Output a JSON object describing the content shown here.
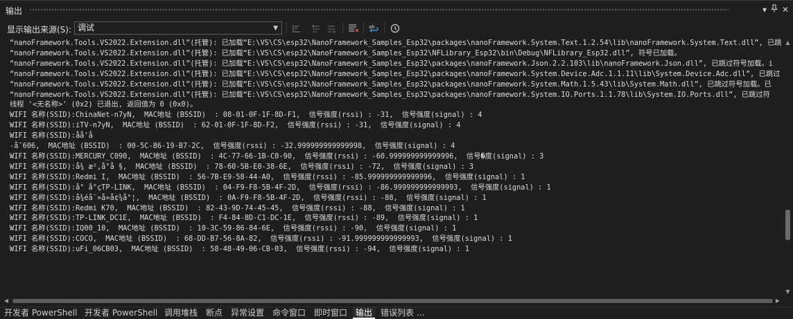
{
  "window": {
    "title": "输出"
  },
  "toolbar": {
    "source_label": "显示输出来源(S):",
    "source_value": "调试"
  },
  "output": {
    "lines": [
      "“nanoFramework.Tools.VS2022.Extension.dll”(托管): 已加载“E:\\VS\\CS\\esp32\\NanoFramework_Samples_Esp32\\packages\\nanoFramework.System.Text.1.2.54\\lib\\nanoFramework.System.Text.dll”, 已跳",
      "“nanoFramework.Tools.VS2022.Extension.dll”(托管): 已加载“E:\\VS\\CS\\esp32\\NanoFramework_Samples_Esp32\\NFLibrary_Esp32\\bin\\Debug\\NFLibrary_Esp32.dll”, 符号已加载。",
      "“nanoFramework.Tools.VS2022.Extension.dll”(托管): 已加载“E:\\VS\\CS\\esp32\\NanoFramework_Samples_Esp32\\packages\\nanoFramework.Json.2.2.103\\lib\\nanoFramework.Json.dll”, 已跳过符号加载。i",
      "“nanoFramework.Tools.VS2022.Extension.dll”(托管): 已加载“E:\\VS\\CS\\esp32\\NanoFramework_Samples_Esp32\\packages\\nanoFramework.System.Device.Adc.1.1.11\\lib\\System.Device.Adc.dll”, 已跳过",
      "“nanoFramework.Tools.VS2022.Extension.dll”(托管): 已加载“E:\\VS\\CS\\esp32\\NanoFramework_Samples_Esp32\\packages\\nanoFramework.System.Math.1.5.43\\lib\\System.Math.dll”, 已跳过符号加载。已",
      "“nanoFramework.Tools.VS2022.Extension.dll”(托管): 已加载“E:\\VS\\CS\\esp32\\NanoFramework_Samples_Esp32\\packages\\nanoFramework.System.IO.Ports.1.1.78\\lib\\System.IO.Ports.dll”, 已跳过符",
      "线程 '<无名称>' (0x2) 已退出, 返回值为 0 (0x0)。",
      "WIFI 名称(SSID):ChinaNet-n7yN,  MAC地址 (BSSID)  : 08-01-0F-1F-8D-F1,  信号强度(rssi) : -31,  信号强度(signal) : 4",
      "WIFI 名称(SSID):iTV-n7yN,  MAC地址 (BSSID)  : 62-01-0F-1F-8D-F2,  信号强度(rssi) : -31,  信号强度(signal) : 4",
      "WIFI 名称(SSID):åå'å",
      "-å¯606,  MAC地址 (BSSID)  : 00-5C-86-19-B7-2C,  信号强度(rssi) : -32.999999999999998,  信号强度(signal) : 4",
      "WIFI 名称(SSID):MERCURY_C090,  MAC地址 (BSSID)  : 4C-77-66-1B-C0-90,  信号强度(rssi) : -60.999999999999996,  信号�度(signal) : 3",
      "WIFI 名称(SSID):å¾ æ²,å°å §,  MAC地址 (BSSID)  : 78-60-5B-E0-38-6E,  信号强度(rssi) : -72,  信号强度(signal) : 3",
      "WIFI 名称(SSID):Redmi I,  MAC地址 (BSSID)  : 56-7B-E9-58-44-A0,  信号强度(rssi) : -85.999999999999996,  信号强度(signal) : 1",
      "WIFI 名称(SSID):å° å°çTP-LINK,  MAC地址 (BSSID)  : 04-F9-F8-5B-4F-2D,  信号强度(rssi) : -86.999999999999993,  信号强度(signal) : 1",
      "WIFI 名称(SSID):å¾éå¨»å»å¢¾å°¦,  MAC地址 (BSSID)  : 0A-F9-F8-5B-4F-2D,  信号强度(rssi) : -88,  信号强度(signal) : 1",
      "WIFI 名称(SSID):Redmi K70,  MAC地址 (BSSID)  : 82-43-9D-74-45-45,  信号强度(rssi) : -88,  信号强度(signal) : 1",
      "WIFI 名称(SSID):TP-LINK_DC1E,  MAC地址 (BSSID)  : F4-84-8D-C1-DC-1E,  信号强度(rssi) : -89,  信号强度(signal) : 1",
      "WIFI 名称(SSID):IQ00_10,  MAC地址 (BSSID)  : 10-3C-59-86-84-6E,  信号强度(rssi) : -90,  信号强度(signal) : 1",
      "WIFI 名称(SSID):COCO,  MAC地址 (BSSID)  : 68-DD-B7-56-8A-82,  信号强度(rssi) : -91.999999999999993,  信号强度(signal) : 1",
      "WIFI 名称(SSID):uFi_06CB03,  MAC地址 (BSSID)  : 58-48-49-06-CB-03,  信号强度(rssi) : -94,  信号强度(signal) : 1"
    ]
  },
  "tabs": [
    {
      "label": "开发者 PowerShell",
      "active": false
    },
    {
      "label": "开发者 PowerShell",
      "active": false
    },
    {
      "label": "调用堆栈",
      "active": false
    },
    {
      "label": "断点",
      "active": false
    },
    {
      "label": "异常设置",
      "active": false
    },
    {
      "label": "命令窗口",
      "active": false
    },
    {
      "label": "即时窗口",
      "active": false
    },
    {
      "label": "输出",
      "active": true
    },
    {
      "label": "错误列表 ...",
      "active": false
    }
  ]
}
